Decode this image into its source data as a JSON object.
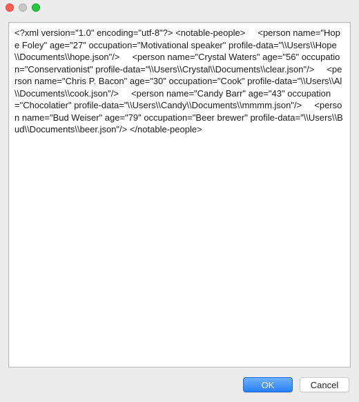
{
  "titlebar": {
    "title": ""
  },
  "textarea": {
    "content": "<?xml version=\"1.0\" encoding=\"utf-8\"?> <notable-people>     <person name=\"Hope Foley\" age=\"27\" occupation=\"Motivational speaker\" profile-data=\"\\\\Users\\\\Hope\\\\Documents\\\\hope.json\"/>     <person name=\"Crystal Waters\" age=\"56\" occupation=\"Conservationist\" profile-data=\"\\\\Users\\\\Crystal\\\\Documents\\\\clear.json\"/>     <person name=\"Chris P. Bacon\" age=\"30\" occupation=\"Cook\" profile-data=\"\\\\Users\\\\Al\\\\Documents\\\\cook.json\"/>     <person name=\"Candy Barr\" age=\"43\" occupation=\"Chocolatier\" profile-data=\"\\\\Users\\\\Candy\\\\Documents\\\\mmmm.json\"/>     <person name=\"Bud Weiser\" age=\"79\" occupation=\"Beer brewer\" profile-data=\"\\\\Users\\\\Bud\\\\Documents\\\\beer.json\"/> </notable-people>"
  },
  "buttons": {
    "ok_label": "OK",
    "cancel_label": "Cancel"
  },
  "colors": {
    "window_bg": "#ececec",
    "text_bg": "#ffffff",
    "primary_button": "#2a7ff3"
  }
}
